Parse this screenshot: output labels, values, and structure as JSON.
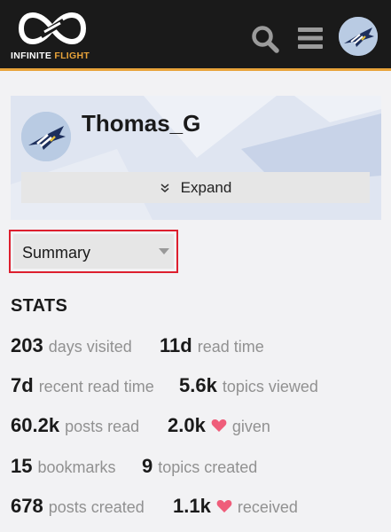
{
  "header": {
    "logo_word1": "INFINITE",
    "logo_word2": "FLIGHT",
    "accent_color": "#e8a33a",
    "icons": [
      "search-icon",
      "menu-icon",
      "avatar"
    ]
  },
  "profile": {
    "username": "Thomas_G",
    "expand_label": "Expand"
  },
  "summary_select": {
    "selected": "Summary"
  },
  "stats": {
    "title": "STATS",
    "items": [
      {
        "value": "203",
        "label": "days visited"
      },
      {
        "value": "11d",
        "label": "read time"
      },
      {
        "value": "7d",
        "label": "recent read time"
      },
      {
        "value": "5.6k",
        "label": "topics viewed"
      },
      {
        "value": "60.2k",
        "label": "posts read"
      },
      {
        "value": "2.0k",
        "label": "given",
        "icon": "heart-icon"
      },
      {
        "value": "15",
        "label": "bookmarks"
      },
      {
        "value": "9",
        "label": "topics created"
      },
      {
        "value": "678",
        "label": "posts created"
      },
      {
        "value": "1.1k",
        "label": "received",
        "icon": "heart-icon"
      }
    ]
  },
  "colors": {
    "heart": "#ef5d7a",
    "highlight_border": "#dd1f2e"
  }
}
